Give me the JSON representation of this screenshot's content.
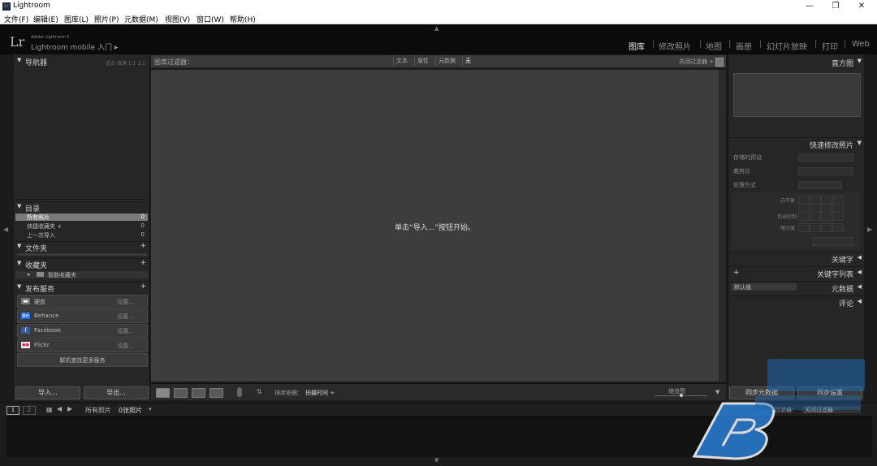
{
  "window": {
    "title": "Lightroom",
    "icon_label": "Lr",
    "minimize": "—",
    "restore": "❐",
    "close": "✕"
  },
  "menu": [
    "文件(F)",
    "编辑(E)",
    "图库(L)",
    "照片(P)",
    "元数据(M)",
    "视图(V)",
    "窗口(W)",
    "帮助(H)"
  ],
  "identity": {
    "logo": "Lr",
    "product": "Adobe Lightroom 5",
    "mobile": "Lightroom mobile 入门",
    "mobile_arrow": "▸"
  },
  "modules": [
    {
      "label": "图库",
      "active": true
    },
    {
      "label": "修改照片",
      "active": false
    },
    {
      "label": "地图",
      "active": false
    },
    {
      "label": "画册",
      "active": false
    },
    {
      "label": "幻灯片放映",
      "active": false
    },
    {
      "label": "打印",
      "active": false
    },
    {
      "label": "Web",
      "active": false
    }
  ],
  "left_panel": {
    "navigator": {
      "title": "导航器",
      "zoom": "适合  填满  1:1  1:1"
    },
    "catalog": {
      "title": "目录",
      "rows": [
        {
          "label": "所有照片",
          "count": "0",
          "selected": true
        },
        {
          "label": "快捷收藏夹 +",
          "count": "0",
          "selected": false
        },
        {
          "label": "上一次导入",
          "count": "0",
          "selected": false
        }
      ]
    },
    "folders": {
      "title": "文件夹",
      "plus": "+"
    },
    "collections": {
      "title": "收藏夹",
      "plus": "+",
      "smart": "智能收藏夹"
    },
    "publish": {
      "title": "发布服务",
      "plus": "+",
      "services": [
        {
          "icon": "▬",
          "name": "硬盘",
          "setup": "设置..."
        },
        {
          "icon": "Bē",
          "name": "Behance",
          "setup": "设置..."
        },
        {
          "icon": "f",
          "name": "Facebook",
          "setup": "设置..."
        },
        {
          "icon": "●●",
          "name": "Flickr",
          "setup": "设置..."
        }
      ],
      "find_more": "联机查找更多服务"
    },
    "import_button": "导入...",
    "export_button": "导出..."
  },
  "filter_bar": {
    "title": "图库过滤器：",
    "tabs": [
      {
        "label": "文本",
        "selected": false
      },
      {
        "label": "属性",
        "selected": false
      },
      {
        "label": "元数据",
        "selected": false
      },
      {
        "label": "无",
        "selected": true
      }
    ],
    "close_filter": "关闭过滤器 ÷"
  },
  "grid": {
    "empty_message": "单击“导入...”按钮开始。"
  },
  "toolbar": {
    "sort_label": "排序依据：",
    "sort_value": "拍摄时间 ÷",
    "thumbnail_label": "缩览图",
    "thumbnail_level": 0.5,
    "menu_arrow": "▼"
  },
  "right_panel": {
    "histogram": {
      "title": "直方图"
    },
    "quick_develop": {
      "title": "快速修改照片",
      "rows": [
        {
          "label": "存储的预设"
        },
        {
          "label": "裁剪比"
        },
        {
          "label": "处理方式"
        }
      ],
      "sub_labels": [
        "白平衡",
        "色调控制",
        "曝光度"
      ]
    },
    "keywording": {
      "title": "关键字"
    },
    "keyword_list": {
      "title": "关键字列表",
      "plus": "+"
    },
    "metadata": {
      "title": "元数据",
      "preset": "默认值"
    },
    "comments": {
      "title": "评论"
    },
    "sync_metadata": "同步元数据",
    "sync_settings": "同步设置"
  },
  "filmstrip_bar": {
    "page_1": "1",
    "page_2": "2",
    "source": "所有照片",
    "count": "0张照片",
    "filter_label": "过滤器：",
    "filter_value": "关闭过滤器"
  }
}
